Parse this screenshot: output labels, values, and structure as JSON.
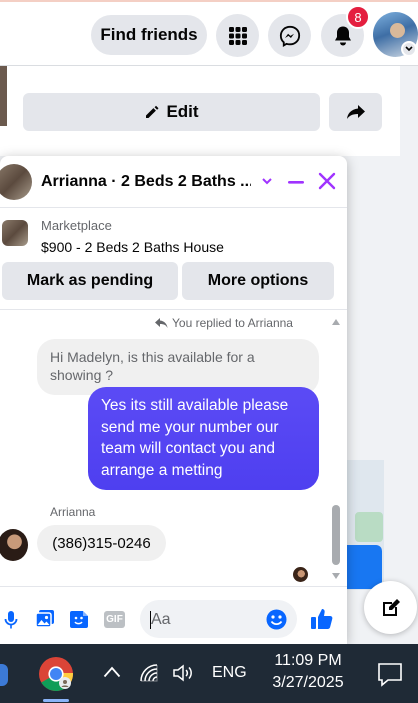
{
  "facebook": {
    "find_friends_label": "Find friends",
    "notification_count": "8",
    "edit_label": "Edit"
  },
  "chat": {
    "header_title": "Arrianna · 2 Beds 2 Baths ...",
    "marketplace_label": "Marketplace",
    "listing_title": "$900 - 2 Beds 2 Baths House",
    "mark_pending_label": "Mark as pending",
    "more_options_label": "More options",
    "replied_note": "You replied to Arrianna",
    "quoted_message": "Hi Madelyn, is this available for a showing ?",
    "my_message": "Yes its still available please send me your number our team will contact you and arrange a  metting",
    "sender_name": "Arrianna",
    "their_message": "(386)315-0246",
    "composer_placeholder": "Aa"
  },
  "taskbar": {
    "language": "ENG",
    "time": "11:09 PM",
    "date": "3/27/2025"
  },
  "colors": {
    "messenger_accent": "#a033ff",
    "outgoing_bubble": "#4e3ff0",
    "facebook_blue": "#1877f2",
    "notification_red": "#e41e3f",
    "taskbar_bg": "#1f2a36"
  }
}
